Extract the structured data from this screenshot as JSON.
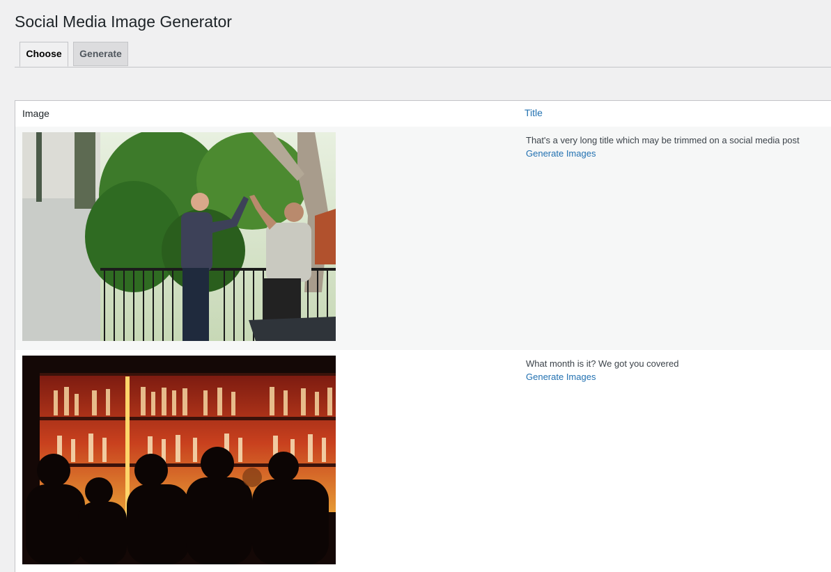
{
  "page": {
    "title": "Social Media Image Generator"
  },
  "tabs": [
    {
      "label": "Choose",
      "active": true
    },
    {
      "label": "Generate",
      "active": false
    }
  ],
  "table": {
    "columns": {
      "image": "Image",
      "title": "Title"
    },
    "rows": [
      {
        "image_icon": "photo-two-men-high-five",
        "title": "That's a very long title which may be trimmed on a social media post",
        "action_label": "Generate Images"
      },
      {
        "image_icon": "photo-bar-crowd",
        "title": "What month is it? We got you covered",
        "action_label": "Generate Images"
      }
    ]
  },
  "colors": {
    "link": "#2271b1",
    "background": "#f0f0f1",
    "border": "#c3c4c7"
  }
}
